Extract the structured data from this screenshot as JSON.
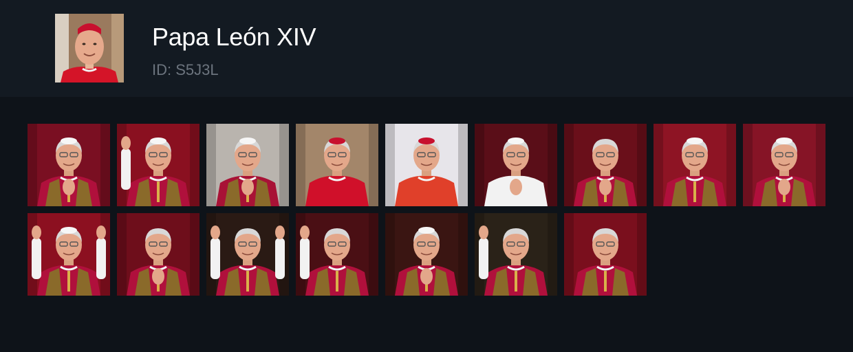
{
  "profile": {
    "name": "Papa León XIV",
    "id_text": "ID: S5J3L",
    "avatar_icon": "portrait-avatar"
  },
  "gallery": {
    "rows": 2,
    "items": [
      {
        "bg": "#7a0f22",
        "robe": "#b0103c",
        "pose": "hands-clasped",
        "cap": "white"
      },
      {
        "bg": "#8a1020",
        "robe": "#b0103c",
        "pose": "wave",
        "cap": "white"
      },
      {
        "bg": "#b9b4ae",
        "robe": "#a81236",
        "pose": "profile-pray",
        "cap": "white"
      },
      {
        "bg": "#a3866a",
        "robe": "#d0102a",
        "pose": "smile",
        "cap": "red"
      },
      {
        "bg": "#e7e5ea",
        "robe": "#e0402a",
        "pose": "smile",
        "cap": "red"
      },
      {
        "bg": "#5a0e18",
        "robe": "#f2f2f2",
        "pose": "pray",
        "cap": "white"
      },
      {
        "bg": "#6a0f1a",
        "robe": "#b0103c",
        "pose": "pray-look-up",
        "cap": "none"
      },
      {
        "bg": "#8e1424",
        "robe": "#b0103c",
        "pose": "side",
        "cap": "white"
      },
      {
        "bg": "#861426",
        "robe": "#b0103c",
        "pose": "pray",
        "cap": "white"
      },
      {
        "bg": "#8c1020",
        "robe": "#b0103c",
        "pose": "arms-out",
        "cap": "white"
      },
      {
        "bg": "#6e0e1b",
        "robe": "#b0103c",
        "pose": "hands-clasped",
        "cap": "none"
      },
      {
        "bg": "#2a1a14",
        "robe": "#b0103c",
        "pose": "arms-up",
        "cap": "none"
      },
      {
        "bg": "#4a0f14",
        "robe": "#b0103c",
        "pose": "wave",
        "cap": "none"
      },
      {
        "bg": "#3a1512",
        "robe": "#b0103c",
        "pose": "pray",
        "cap": "white"
      },
      {
        "bg": "#2a2218",
        "robe": "#b0103c",
        "pose": "wave",
        "cap": "none"
      },
      {
        "bg": "#7a0f1d",
        "robe": "#b0103c",
        "pose": "look-up",
        "cap": "none"
      }
    ]
  },
  "colors": {
    "background": "#0e1319",
    "header": "#131a22",
    "title": "#ffffff",
    "subtitle": "#6c747e"
  }
}
